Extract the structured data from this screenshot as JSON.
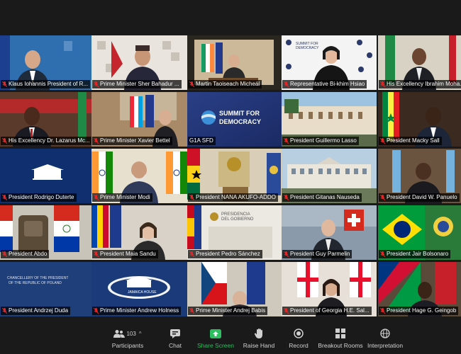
{
  "tiles": [
    {
      "name": "Klaus Iohannis President of R...",
      "active": false
    },
    {
      "name": "Prime Minister Sher Bahadur ...",
      "active": false
    },
    {
      "name": "Martin Taoiseach Micheál",
      "active": false
    },
    {
      "name": "Representative Bi-khim Hsiao",
      "active": false
    },
    {
      "name": "His Excellency Ibrahim Moha...",
      "active": false
    },
    {
      "name": "His Excellency Dr. Lazarus Mc...",
      "active": false
    },
    {
      "name": "Prime Minister Xavier Bettel",
      "active": false
    },
    {
      "name": "G1A SFD",
      "active": true
    },
    {
      "name": "President Guillermo Lasso",
      "active": false
    },
    {
      "name": "President Macky Sall",
      "active": false
    },
    {
      "name": "President Rodrigo Duterte",
      "active": false
    },
    {
      "name": "Prime Minister  Modi",
      "active": false
    },
    {
      "name": "President NANA AKUFO-ADDO",
      "active": false
    },
    {
      "name": "President Gitanas Nauseda",
      "active": false
    },
    {
      "name": "President David W. Panuelo",
      "active": false
    },
    {
      "name": "President Abdo",
      "active": false
    },
    {
      "name": "President Maia Sandu",
      "active": false
    },
    {
      "name": "President Pedro Sánchez",
      "active": false
    },
    {
      "name": "President Guy Parmelin",
      "active": false
    },
    {
      "name": "President Jair Bolsonaro",
      "active": false
    },
    {
      "name": "President Andrzej Duda",
      "active": false
    },
    {
      "name": "Prime Minister Andrew Holness",
      "active": false
    },
    {
      "name": "Prime Minister Andrej Babis",
      "active": false
    },
    {
      "name": "President of Georgia H.E. Sal...",
      "active": false
    },
    {
      "name": "President Hage G. Geingob",
      "active": false
    }
  ],
  "tile_text": {
    "summit_line1": "SUMMIT FOR",
    "summit_line2": "DEMOCRACY",
    "summit_small1": "SUMMIT FOR",
    "summit_small2": "DEMOCRACY",
    "presidencia1": "PRESIDENCIA",
    "presidencia2": "DEL GOBIERNO",
    "poland1": "CHANCELLERY OF THE PRESIDENT",
    "poland2": "OF THE REPUBLIC OF POLAND",
    "jamaica1": "JAMAICA HOUSE"
  },
  "toolbar": {
    "participants_label": "Participants",
    "participants_count": "103",
    "chat_label": "Chat",
    "share_label": "Share Screen",
    "raise_label": "Raise Hand",
    "record_label": "Record",
    "breakout_label": "Breakout Rooms",
    "interpretation_label": "Interpretation"
  },
  "colors": {
    "active_border": "#e5d36a",
    "share_green": "#2dbe60",
    "mute_red": "#e02828"
  }
}
